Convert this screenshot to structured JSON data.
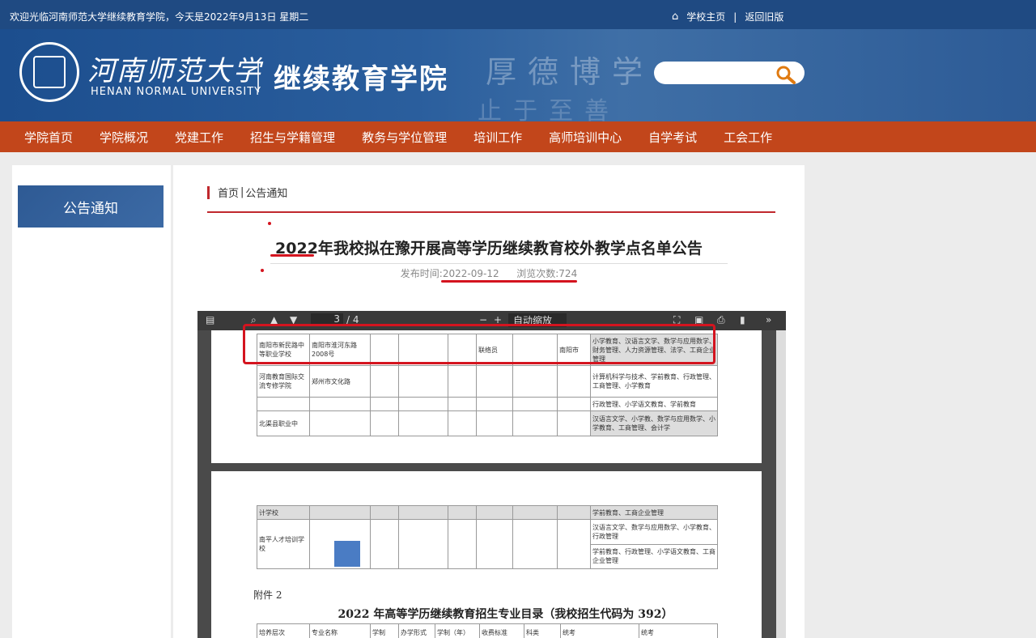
{
  "topbar": {
    "welcome": "欢迎光临河南师范大学继续教育学院，今天是2022年9月13日 星期二",
    "home_link": "学校主页",
    "separator": "|",
    "old_link": "返回旧版"
  },
  "header": {
    "university_cn": "河南师范大学",
    "university_en": "HENAN NORMAL UNIVERSITY",
    "college": "继续教育学院",
    "motto_line1": "厚德博学",
    "motto_line2": "止于至善",
    "search_placeholder": ""
  },
  "nav": [
    "学院首页",
    "学院概况",
    "党建工作",
    "招生与学籍管理",
    "教务与学位管理",
    "培训工作",
    "高师培训中心",
    "自学考试",
    "工会工作"
  ],
  "sidebar": {
    "title": "公告通知"
  },
  "breadcrumb": {
    "home": "首页",
    "sep": "|",
    "current": "公告通知"
  },
  "article": {
    "title": "2022年我校拟在豫开展高等学历继续教育校外教学点名单公告",
    "publish_label": "发布时间:",
    "publish_date": "2022-09-12",
    "views_label": "浏览次数:",
    "views": "724"
  },
  "pdf": {
    "page_current": "3",
    "page_total": "/ 4",
    "zoom": "自动缩放",
    "attachment_label": "附件 2",
    "doc_title": "2022 年高等学历继续教育招生专业目录（我校招生代码为 392）",
    "table_rows": [
      [
        "南阳市新民路中等职业学校",
        "南阳市淮河东路2008号",
        "",
        "",
        "",
        "联络员",
        "",
        "南阳市",
        "小学教育、汉语言文学、数学与应用数学、财务管理、人力资源管理、法学、工商企业管理"
      ],
      [
        "河南教育国际交流专修学院",
        "郑州市文化路",
        "",
        "",
        "",
        "",
        "",
        "",
        "计算机科学与技术、学前教育、行政管理、工商管理、小学教育"
      ],
      [
        "",
        "",
        "",
        "",
        "",
        "",
        "",
        "",
        "行政管理、小学语文教育、学前教育"
      ],
      [
        "北渠县职业中",
        "",
        "",
        "",
        "",
        "",
        "",
        "",
        "汉语言文学、小学教、数学与应用数学、小学教育、工商管理、会计学"
      ]
    ],
    "table2_rows": [
      [
        "计学校",
        "",
        "",
        "",
        "",
        "",
        "",
        "",
        "学前教育、工商企业管理"
      ],
      [
        "南平人才培训学校",
        "",
        "",
        "",
        "",
        "",
        "",
        "",
        "汉语言文学、数学与应用数学、小学教育、行政管理"
      ],
      [
        "",
        "",
        "",
        "",
        "",
        "",
        "",
        "",
        "学前教育、行政管理、小学语文教育、工商企业管理"
      ]
    ],
    "header_row": [
      "培养层次",
      "专业名称",
      "学制",
      "办学形式",
      "学制（年）",
      "收费标准",
      "科类",
      "统考",
      "统考"
    ]
  }
}
